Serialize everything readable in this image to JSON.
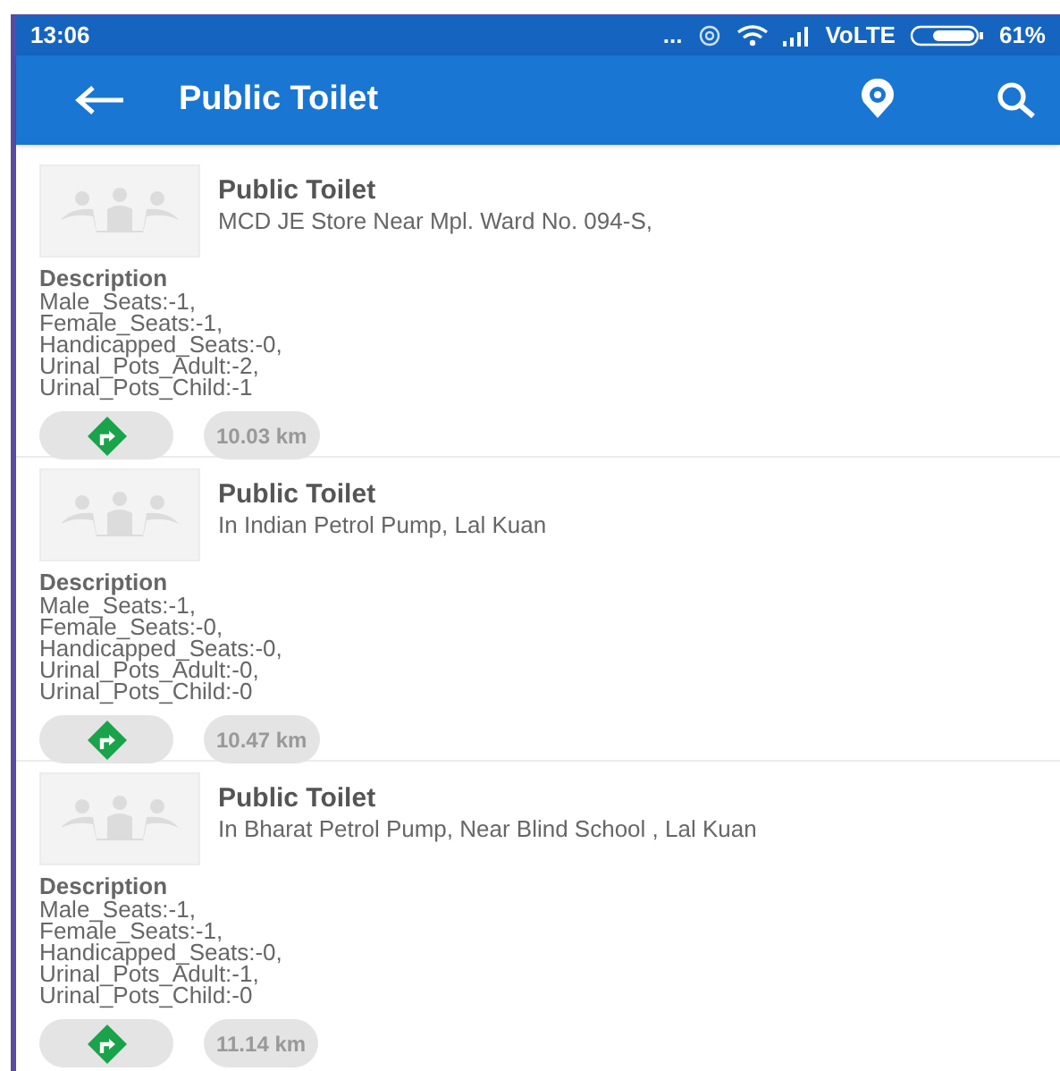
{
  "status_bar": {
    "time": "13:06",
    "dots": "...",
    "network": "VoLTE",
    "battery": "61%"
  },
  "app_bar": {
    "title": "Public Toilet"
  },
  "items": [
    {
      "title": "Public Toilet",
      "address": "MCD JE Store Near Mpl. Ward No. 094-S,",
      "description_label": "Description",
      "description": [
        "Male_Seats:-1,",
        "Female_Seats:-1,",
        "Handicapped_Seats:-0,",
        "Urinal_Pots_Adult:-2,",
        "Urinal_Pots_Child:-1"
      ],
      "distance": "10.03 km"
    },
    {
      "title": "Public Toilet",
      "address": "In  Indian Petrol Pump, Lal Kuan",
      "description_label": "Description",
      "description": [
        "Male_Seats:-1,",
        "Female_Seats:-0,",
        "Handicapped_Seats:-0,",
        "Urinal_Pots_Adult:-0,",
        "Urinal_Pots_Child:-0"
      ],
      "distance": "10.47 km"
    },
    {
      "title": "Public Toilet",
      "address": "In Bharat Petrol Pump, Near Blind School , Lal Kuan",
      "description_label": "Description",
      "description": [
        "Male_Seats:-1,",
        "Female_Seats:-1,",
        "Handicapped_Seats:-0,",
        "Urinal_Pots_Adult:-1,",
        "Urinal_Pots_Child:-0"
      ],
      "distance": "11.14 km"
    }
  ]
}
